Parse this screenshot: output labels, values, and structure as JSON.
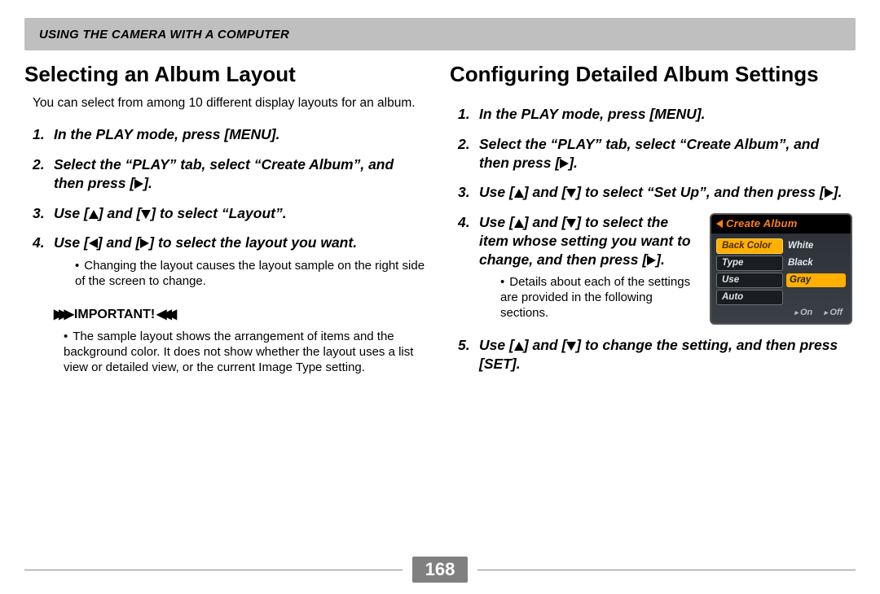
{
  "header": "USING THE CAMERA WITH A COMPUTER",
  "page_number": "168",
  "left": {
    "title": "Selecting an Album Layout",
    "intro": "You can select from among 10 different display layouts for an album.",
    "steps": [
      {
        "n": "1.",
        "t": "In the PLAY mode, press [MENU]."
      },
      {
        "n": "2.",
        "t_pre": "Select the “PLAY” tab, select  “Create Album”, and then press [",
        "t_post": "].",
        "icon": "right"
      },
      {
        "n": "3.",
        "t_pre": "Use [",
        "t_mid": "] and [",
        "t_post": "] to select “Layout”.",
        "icon1": "up",
        "icon2": "down"
      },
      {
        "n": "4.",
        "t_pre": "Use [",
        "t_mid": "] and [",
        "t_post": "] to select the layout you want.",
        "icon1": "left",
        "icon2": "right",
        "sub": "Changing the layout causes the layout sample on the right side of the screen to change."
      }
    ],
    "important_label": "IMPORTANT!",
    "important_text": "The sample layout shows the arrangement of items and the background color. It does not show whether the layout uses a list view or detailed view, or the current Image Type setting."
  },
  "right": {
    "title": "Configuring Detailed Album Settings",
    "steps": [
      {
        "n": "1.",
        "t": "In the PLAY mode, press [MENU]."
      },
      {
        "n": "2.",
        "t_pre": "Select the “PLAY” tab, select  “Create Album”, and then press [",
        "t_post": "].",
        "icon": "right"
      },
      {
        "n": "3.",
        "t_pre": "Use [",
        "t_mid": "] and [",
        "t_mid2": "] to select “Set Up”, and then press [",
        "t_post": "].",
        "icon1": "up",
        "icon2": "down",
        "icon3": "right"
      },
      {
        "n": "4.",
        "t_pre": "Use [",
        "t_mid": "] and [",
        "t_post": "] to select the item whose setting you want to change, and then press [",
        "t_post2": "].",
        "icon1": "up",
        "icon2": "down",
        "icon3": "right",
        "sub": "Details about each of the settings are provided in the following sections.",
        "has_lcd": true
      },
      {
        "n": "5.",
        "t_pre": "Use [",
        "t_mid": "] and [",
        "t_post": "] to change the setting, and then press [SET].",
        "icon1": "up",
        "icon2": "down"
      }
    ]
  },
  "lcd": {
    "title": "Create Album",
    "rows": [
      {
        "left": "Back Color",
        "right": "White",
        "sel_left": true
      },
      {
        "left": "Type",
        "right": "Black"
      },
      {
        "left": "Use",
        "right": "Gray",
        "sel_right": true
      },
      {
        "left": "Auto"
      }
    ],
    "onoff": {
      "on": "On",
      "off": "Off"
    }
  }
}
